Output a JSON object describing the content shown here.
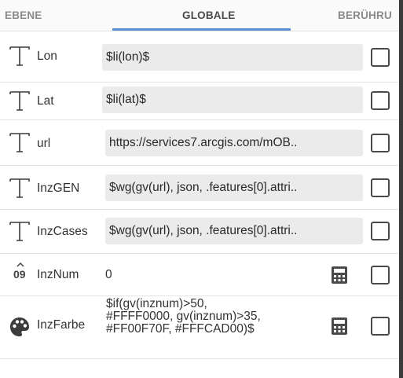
{
  "tabs": [
    {
      "label": "EBENE",
      "active": false
    },
    {
      "label": "GLOBALE",
      "active": true
    },
    {
      "label": "BERÜHRU",
      "active": false
    }
  ],
  "accent_color": "#5d8fd4",
  "rows": [
    {
      "label": "Lon",
      "value": "$li(lon)$",
      "icon": "text-type-icon"
    },
    {
      "label": "Lat",
      "value": "$li(lat)$",
      "icon": "text-type-icon"
    },
    {
      "label": "url",
      "value": "https://services7.arcgis.com/mOB..",
      "icon": "text-type-icon"
    },
    {
      "label": "InzGEN",
      "value": "$wg(gv(url), json, .features[0].attri..",
      "icon": "text-type-icon"
    },
    {
      "label": "InzCases",
      "value": "$wg(gv(url), json, .features[0].attri..",
      "icon": "text-type-icon"
    },
    {
      "label": "InzNum",
      "value": "0",
      "icon": "number-type-icon",
      "icon_text": "09"
    },
    {
      "label": "InzFarbe",
      "value_lines": [
        "$if(gv(inznum)>50,",
        "#FFFF0000, gv(inznum)>35,",
        "#FF00F70F, #FFFCAD00)$"
      ],
      "icon": "palette-icon"
    }
  ]
}
